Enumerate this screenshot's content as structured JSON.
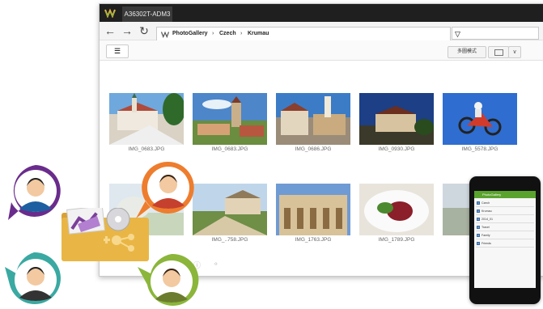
{
  "window": {
    "tab_title": "A36302T-ADM3",
    "logo_icon": "photogallery-logo-icon"
  },
  "toolbar": {
    "back_icon": "←",
    "forward_icon": "→",
    "refresh_icon": "↻",
    "breadcrumb": [
      "PhotoGallery",
      "Czech",
      "Krumau"
    ],
    "breadcrumb_separator": "›",
    "filter_icon": "▽"
  },
  "subbar": {
    "list_icon": "☰",
    "mode_label": "多圖模式",
    "view_dropdown": "∨"
  },
  "photos": [
    {
      "caption": "IMG_0683.JPG",
      "scene": "church-town"
    },
    {
      "caption": "IMG_0683.JPG",
      "scene": "castle-hill"
    },
    {
      "caption": "IMG_0686.JPG",
      "scene": "old-square"
    },
    {
      "caption": "IMG_0930.JPG",
      "scene": "night-sky"
    },
    {
      "caption": "IMG_5578.JPG",
      "scene": "motocross"
    },
    {
      "caption": "",
      "scene": "bright-garden"
    },
    {
      "caption": "IMG_..758.JPG",
      "scene": "palace-lawn"
    },
    {
      "caption": "IMG_1763.JPG",
      "scene": "palace-facade"
    },
    {
      "caption": "IMG_1789.JPG",
      "scene": "food-plate"
    },
    {
      "caption": "",
      "scene": "partial"
    }
  ],
  "tablet": {
    "rows": [
      "PhotoGallery",
      "Czech",
      "Krumau",
      "2014_01",
      "Travel",
      "Family",
      "Friends"
    ]
  },
  "colors": {
    "titlebar": "#1f1f1f",
    "avatar_purple": "#6a2c8c",
    "avatar_orange": "#ee7d2e",
    "avatar_teal": "#3aa9a2",
    "avatar_green": "#8bb63b",
    "folder": "#e9b645",
    "tablet_green": "#5aa32d"
  }
}
